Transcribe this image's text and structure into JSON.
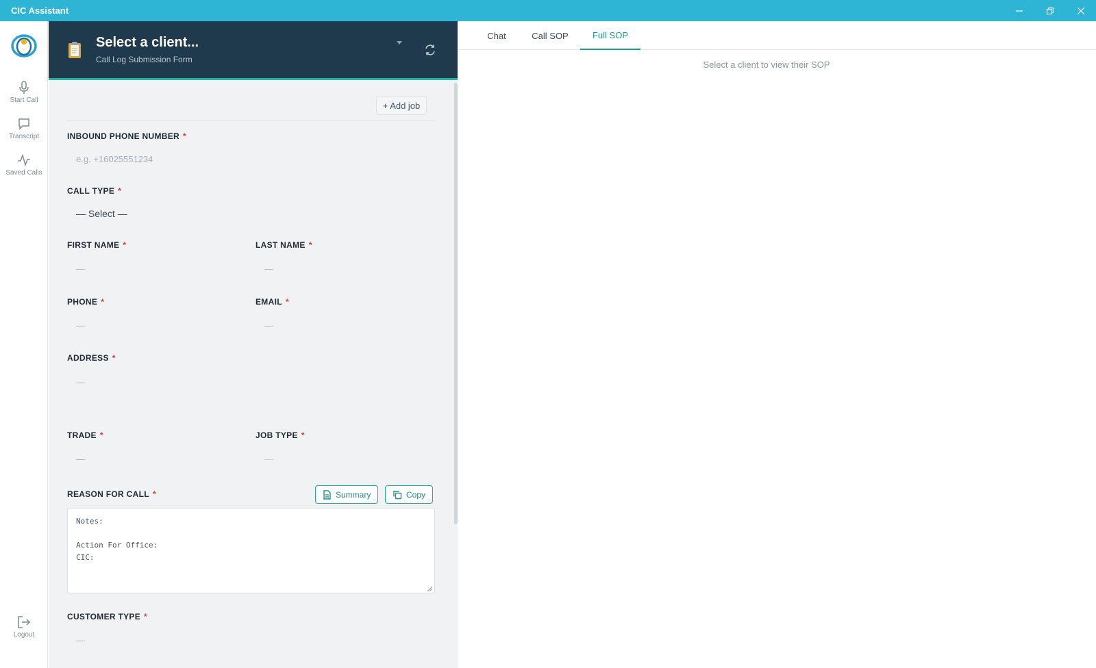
{
  "window": {
    "title": "CIC Assistant"
  },
  "rail": {
    "items": [
      {
        "label": "Start Call",
        "icon": "microphone-icon"
      },
      {
        "label": "Transcript",
        "icon": "chat-bubble-icon"
      },
      {
        "label": "Saved Calls",
        "icon": "pulse-icon"
      }
    ],
    "logout": {
      "label": "Logout",
      "icon": "logout-icon"
    }
  },
  "header": {
    "client_title": "Select a client...",
    "subtitle": "Call Log Submission Form"
  },
  "form": {
    "add_job": "+ Add job",
    "inbound_phone": {
      "label": "INBOUND PHONE NUMBER",
      "placeholder": "e.g. +16025551234"
    },
    "call_type": {
      "label": "CALL TYPE",
      "value": "— Select —"
    },
    "first_name": {
      "label": "FIRST NAME",
      "value": "—"
    },
    "last_name": {
      "label": "LAST NAME",
      "value": "—"
    },
    "phone": {
      "label": "PHONE",
      "value": "—"
    },
    "email": {
      "label": "EMAIL",
      "value": "—"
    },
    "address": {
      "label": "ADDRESS",
      "value": "—"
    },
    "trade": {
      "label": "TRADE",
      "value": "—"
    },
    "job_type": {
      "label": "JOB TYPE",
      "value": "—"
    },
    "reason": {
      "label": "REASON FOR CALL",
      "summary_label": "Summary",
      "copy_label": "Copy",
      "notes": "Notes:\n\nAction For Office:\nCIC:"
    },
    "customer_type": {
      "label": "CUSTOMER TYPE",
      "value": "—"
    },
    "required_mark": "*"
  },
  "tabs": [
    {
      "label": "Chat"
    },
    {
      "label": "Call SOP"
    },
    {
      "label": "Full SOP"
    }
  ],
  "sop": {
    "empty_message": "Select a client to view their SOP"
  },
  "colors": {
    "titlebar": "#2eb5d6",
    "header": "#1e3a4c",
    "accent": "#1f9b8f",
    "required": "#e53935"
  }
}
